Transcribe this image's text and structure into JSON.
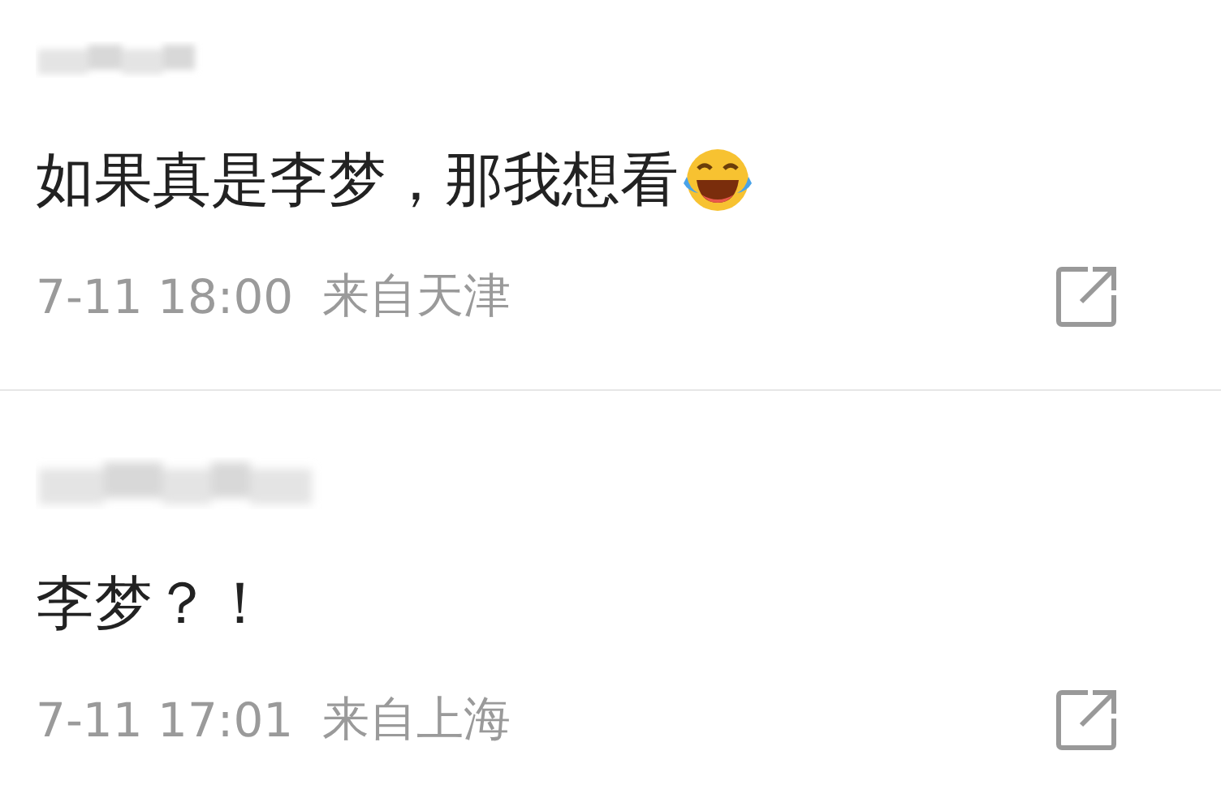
{
  "comments": [
    {
      "text": "如果真是李梦，那我想看",
      "laughing_emoji": true,
      "date": "7-11 18:00",
      "location": "来自天津"
    },
    {
      "text": "李梦？！",
      "laughing_emoji": false,
      "date": "7-11 17:01",
      "location": "来自上海"
    }
  ]
}
